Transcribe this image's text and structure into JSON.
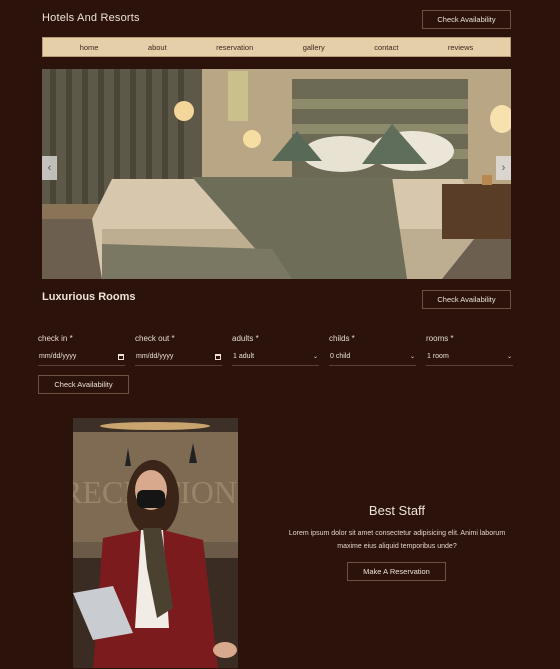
{
  "header": {
    "brand": "Hotels And Resorts",
    "cta_label": "Check Availability"
  },
  "nav": {
    "items": [
      "home",
      "about",
      "reservation",
      "gallery",
      "contact",
      "reviews"
    ]
  },
  "hero": {
    "prev_glyph": "‹",
    "next_glyph": "›"
  },
  "rooms": {
    "title": "Luxurious Rooms",
    "cta_label": "Check Availability"
  },
  "booking_form": {
    "fields": [
      {
        "label": "check in *",
        "value": "mm/dd/yyyy",
        "icon": "calendar-icon"
      },
      {
        "label": "check out *",
        "value": "mm/dd/yyyy",
        "icon": "calendar-icon"
      },
      {
        "label": "adults *",
        "value": "1 adult",
        "icon": "chevron-down-icon"
      },
      {
        "label": "childs *",
        "value": "0 child",
        "icon": "chevron-down-icon"
      },
      {
        "label": "rooms *",
        "value": "1 room",
        "icon": "chevron-down-icon"
      }
    ],
    "submit_label": "Check Availability"
  },
  "staff": {
    "title": "Best Staff",
    "text": "Lorem ipsum dolor sit amet consectetur adipisicing elit. Animi laborum maxime eius aliquid temporibus unde?",
    "cta_label": "Make A Reservation",
    "sign_text": "RECEPTION"
  }
}
